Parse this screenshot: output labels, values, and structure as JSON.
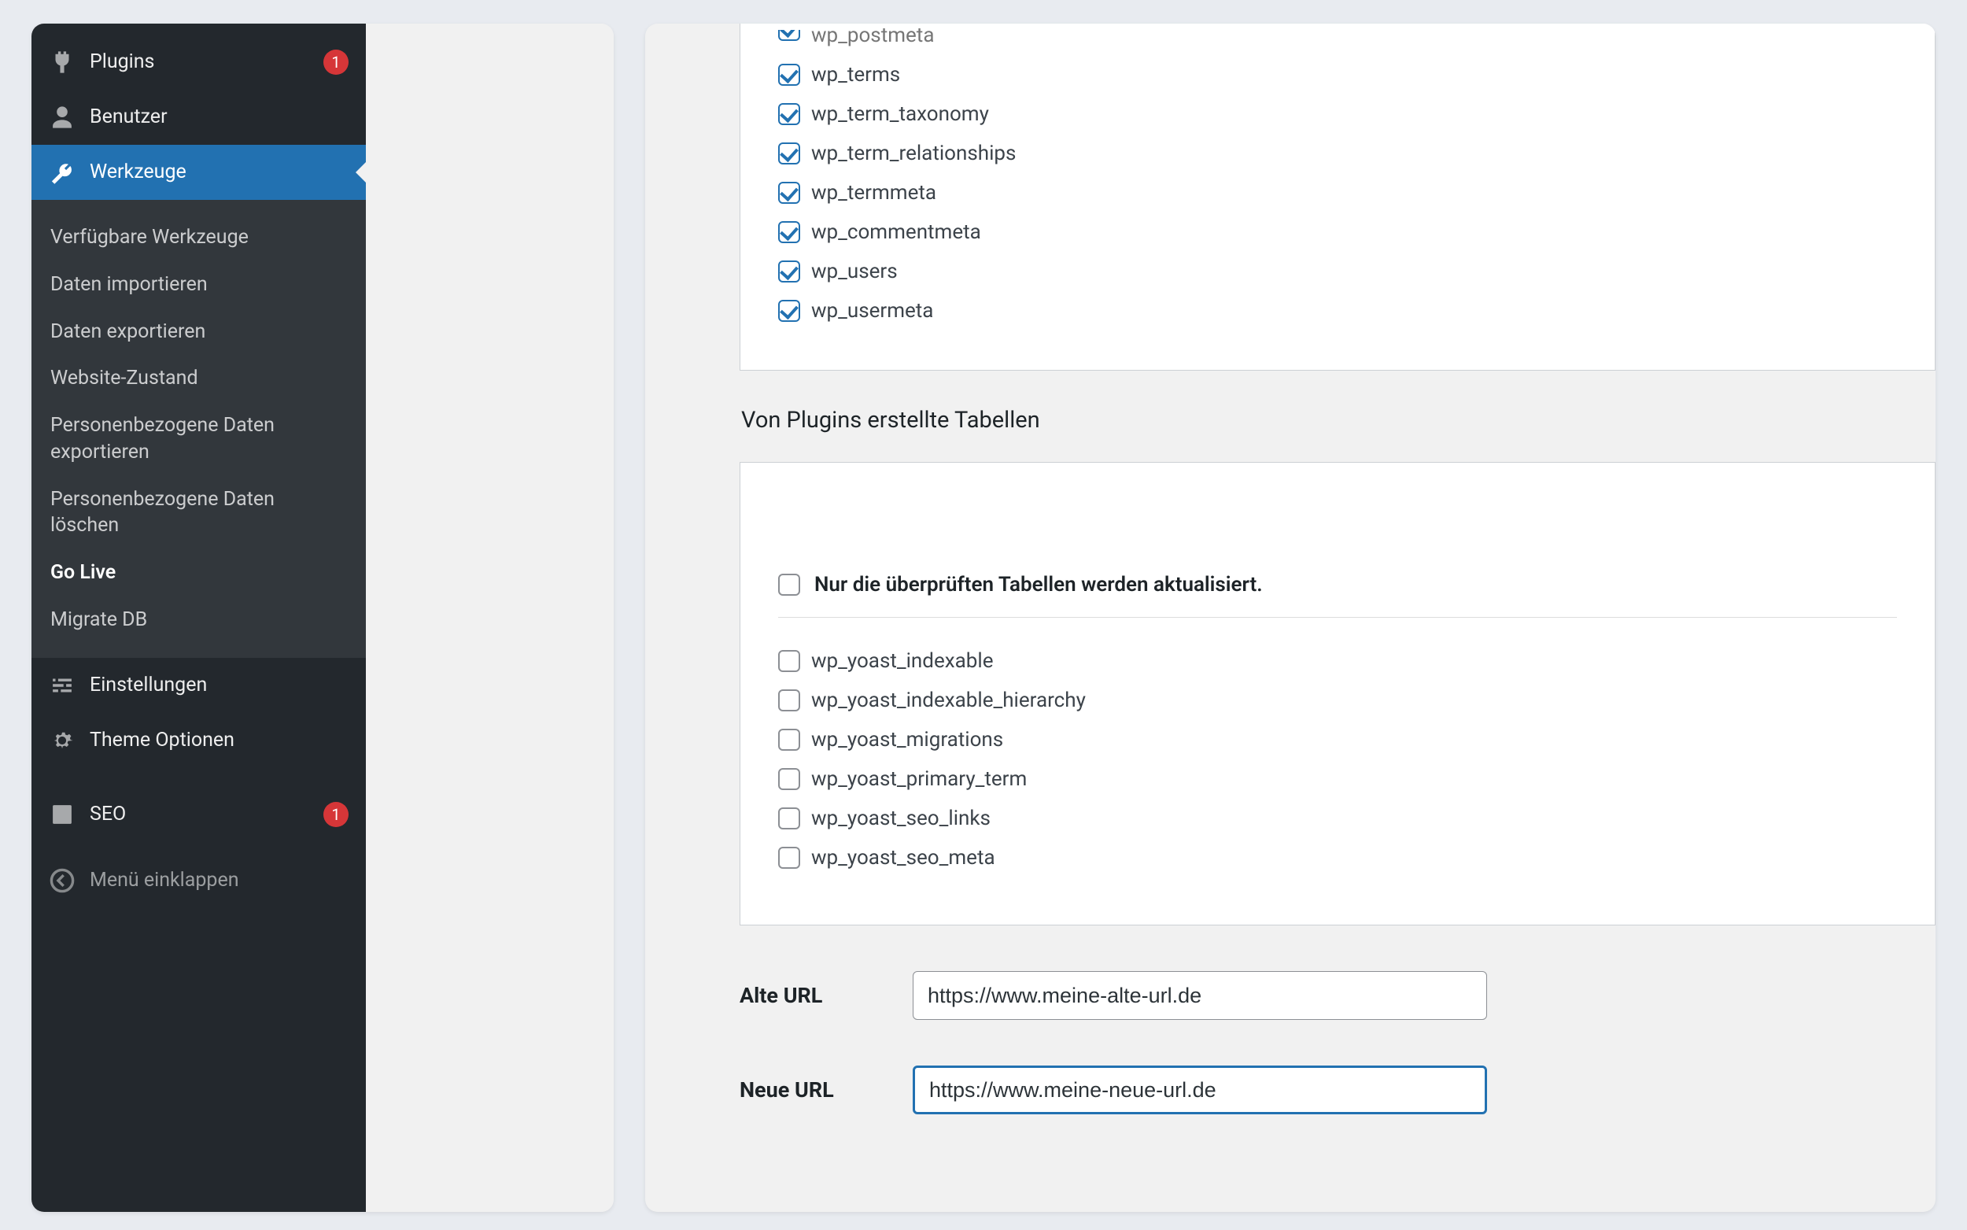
{
  "sidebar": {
    "plugins": {
      "label": "Plugins",
      "badge": "1"
    },
    "users": {
      "label": "Benutzer"
    },
    "tools": {
      "label": "Werkzeuge"
    },
    "submenu": [
      {
        "label": "Verfügbare Werkzeuge",
        "key": "available"
      },
      {
        "label": "Daten importieren",
        "key": "import"
      },
      {
        "label": "Daten exportieren",
        "key": "export"
      },
      {
        "label": "Website-Zustand",
        "key": "health"
      },
      {
        "label": "Personenbezogene Daten exportieren",
        "key": "pd-export"
      },
      {
        "label": "Personenbezogene Daten löschen",
        "key": "pd-erase"
      },
      {
        "label": "Go Live",
        "key": "golive",
        "current": true
      },
      {
        "label": "Migrate DB",
        "key": "migratedb"
      }
    ],
    "settings": {
      "label": "Einstellungen"
    },
    "theme_options": {
      "label": "Theme Optionen"
    },
    "seo": {
      "label": "SEO",
      "badge": "1"
    },
    "collapse": {
      "label": "Menü einklappen"
    }
  },
  "main": {
    "wp_tables": [
      {
        "label": "wp_postmeta",
        "checked": true,
        "cut": true
      },
      {
        "label": "wp_terms",
        "checked": true
      },
      {
        "label": "wp_term_taxonomy",
        "checked": true
      },
      {
        "label": "wp_term_relationships",
        "checked": true
      },
      {
        "label": "wp_termmeta",
        "checked": true
      },
      {
        "label": "wp_commentmeta",
        "checked": true
      },
      {
        "label": "wp_users",
        "checked": true
      },
      {
        "label": "wp_usermeta",
        "checked": true
      }
    ],
    "plugin_section_title": "Von Plugins erstellte Tabellen",
    "plugin_note": "Nur die überprüften Tabellen werden aktualisiert.",
    "plugin_tables": [
      {
        "label": "wp_yoast_indexable",
        "checked": false
      },
      {
        "label": "wp_yoast_indexable_hierarchy",
        "checked": false
      },
      {
        "label": "wp_yoast_migrations",
        "checked": false
      },
      {
        "label": "wp_yoast_primary_term",
        "checked": false
      },
      {
        "label": "wp_yoast_seo_links",
        "checked": false
      },
      {
        "label": "wp_yoast_seo_meta",
        "checked": false
      }
    ],
    "old_url": {
      "label": "Alte URL",
      "value": "https://www.meine-alte-url.de"
    },
    "new_url": {
      "label": "Neue URL",
      "value": "https://www.meine-neue-url.de"
    }
  }
}
